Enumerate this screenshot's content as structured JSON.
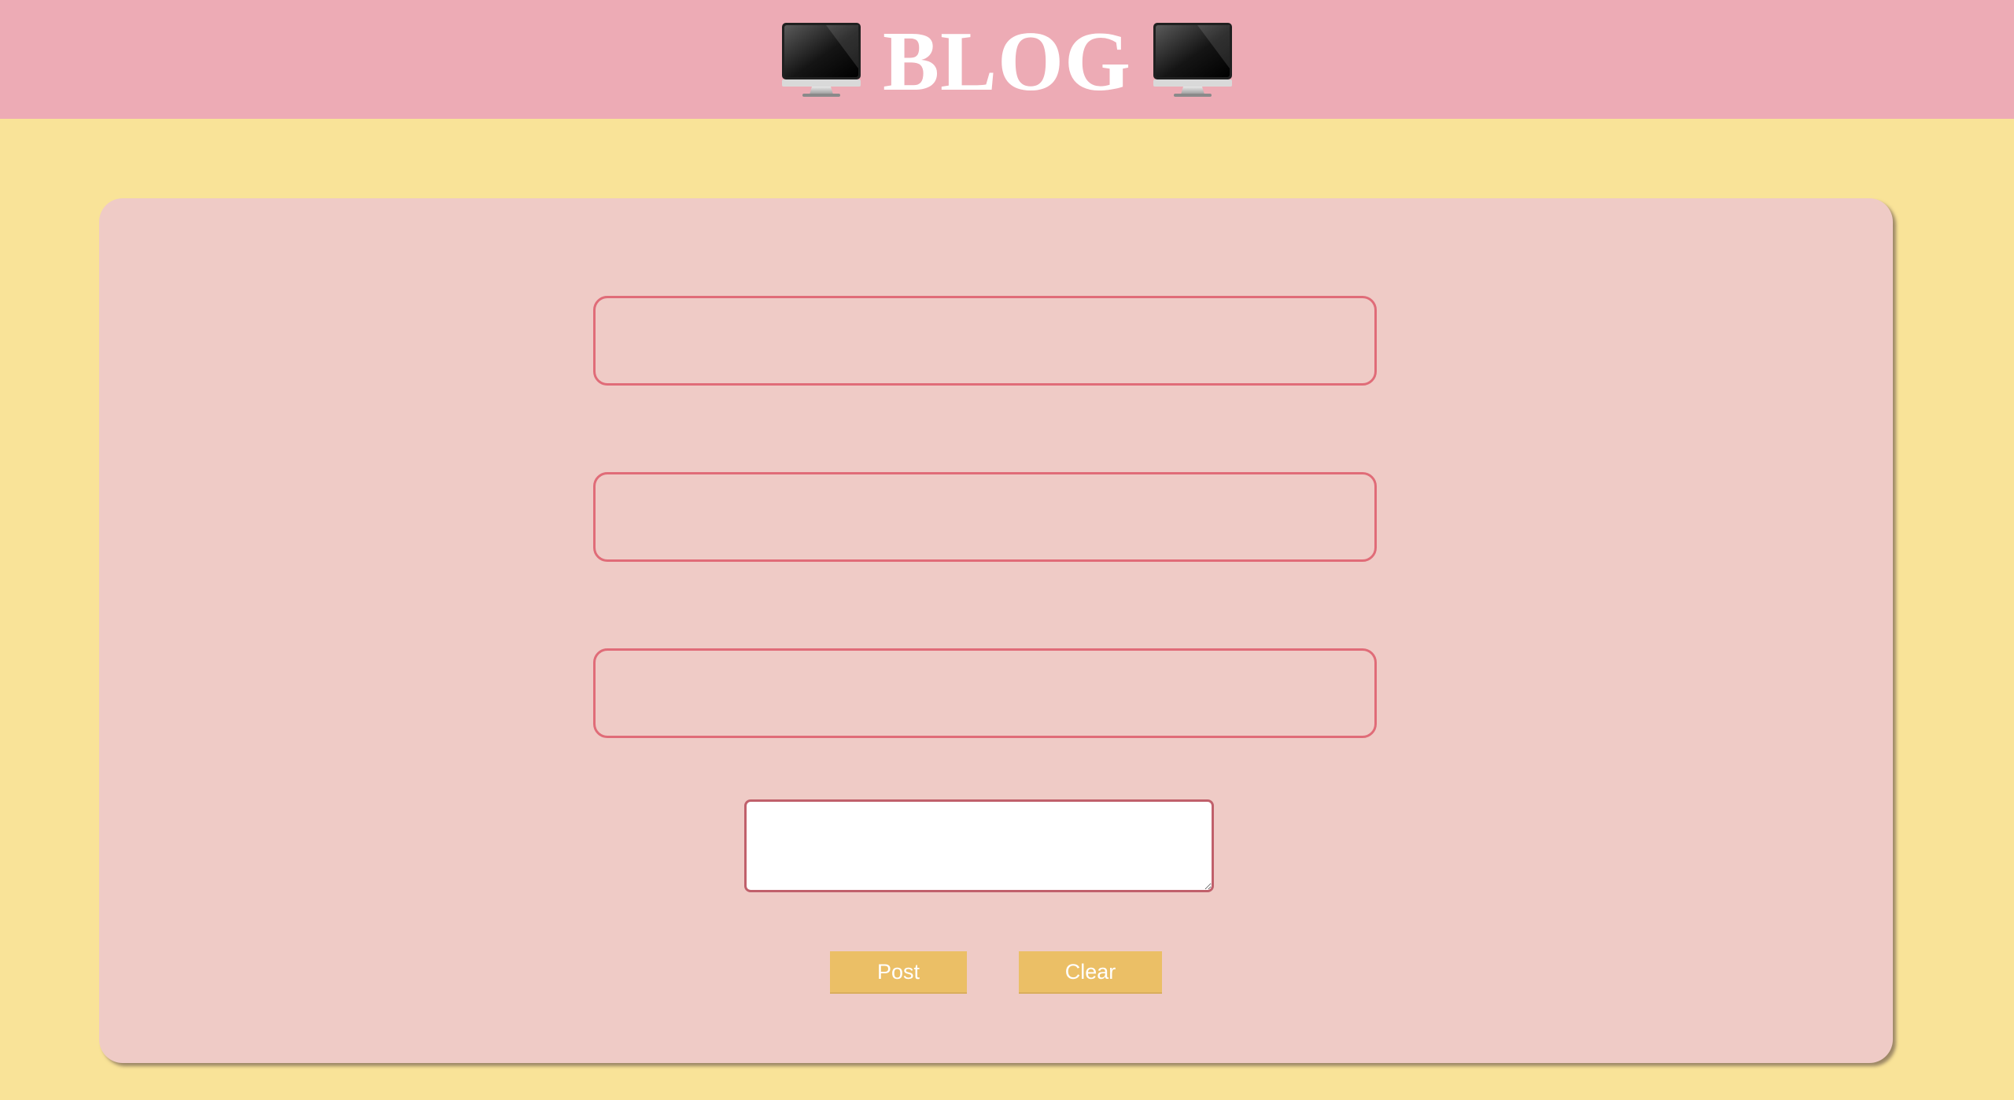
{
  "header": {
    "title": "BLOG",
    "icon_left": "desktop-computer-icon",
    "icon_right": "desktop-computer-icon",
    "background_color": "#edabb5"
  },
  "form": {
    "field_1": {
      "value": "",
      "placeholder": ""
    },
    "field_2": {
      "value": "",
      "placeholder": ""
    },
    "field_3": {
      "value": "",
      "placeholder": ""
    },
    "message": {
      "value": "",
      "placeholder": ""
    },
    "post_label": "Post",
    "clear_label": "Clear"
  },
  "colors": {
    "page_background": "#f9e398",
    "card_background": "#efcbc6",
    "field_border": "#e06c78",
    "button_background": "#ebbf66"
  }
}
